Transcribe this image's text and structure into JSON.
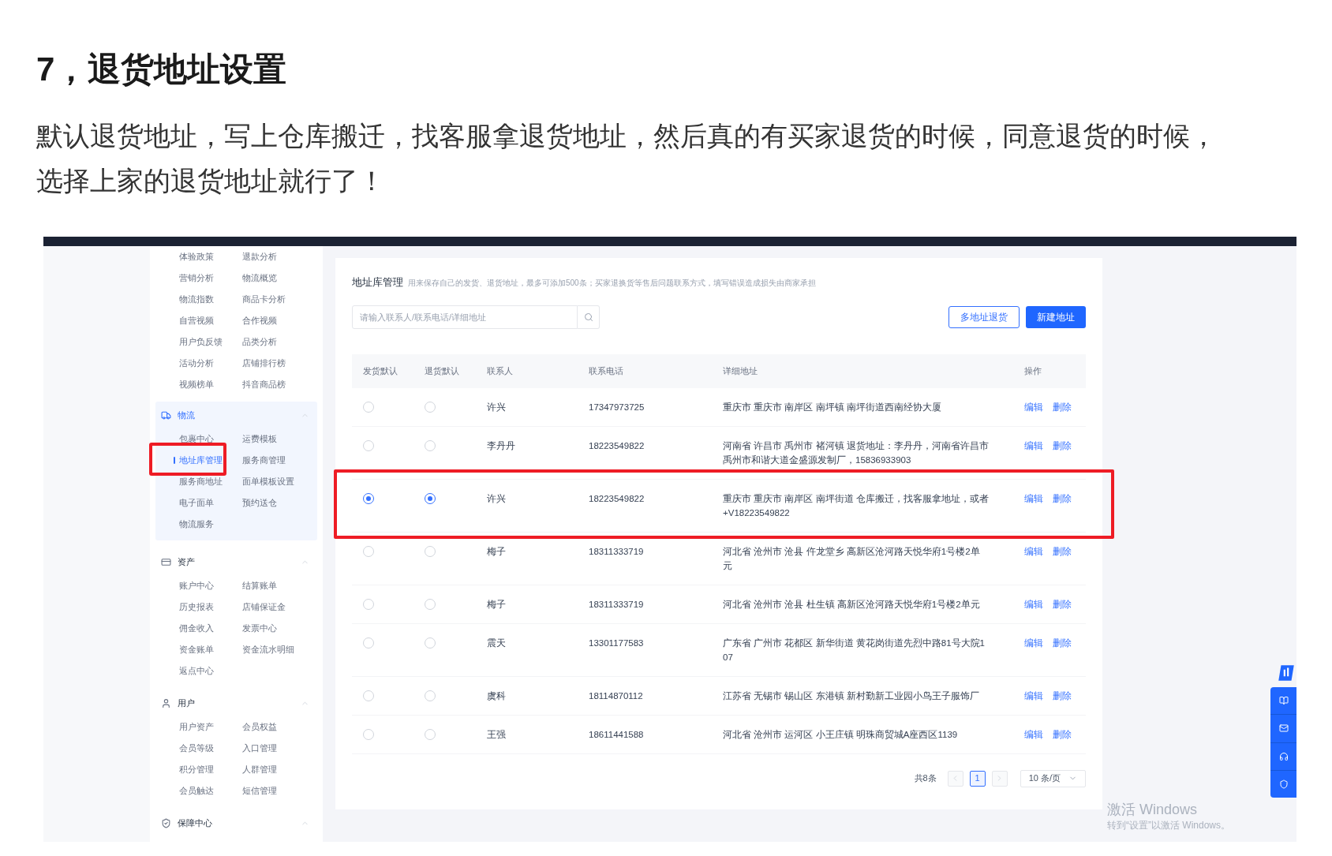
{
  "article": {
    "heading": "7，退货地址设置",
    "paragraph": "默认退货地址，写上仓库搬迁，找客服拿退货地址，然后真的有买家退货的时候，同意退货的时候，选择上家的退货地址就行了！"
  },
  "sidebar": {
    "groups": [
      {
        "items": [
          {
            "label": "体验政策",
            "selected": false,
            "highlighted": false
          },
          {
            "label": "退款分析",
            "selected": false,
            "highlighted": false
          },
          {
            "label": "营销分析",
            "selected": false,
            "highlighted": false
          },
          {
            "label": "物流概览",
            "selected": false,
            "highlighted": false
          },
          {
            "label": "物流指数",
            "selected": false,
            "highlighted": false
          },
          {
            "label": "商品卡分析",
            "selected": false,
            "highlighted": false
          },
          {
            "label": "自营视频",
            "selected": false,
            "highlighted": false
          },
          {
            "label": "合作视频",
            "selected": false,
            "highlighted": false
          },
          {
            "label": "用户负反馈",
            "selected": false,
            "highlighted": false
          },
          {
            "label": "品类分析",
            "selected": false,
            "highlighted": false
          },
          {
            "label": "活动分析",
            "selected": false,
            "highlighted": false
          },
          {
            "label": "店铺排行榜",
            "selected": false,
            "highlighted": false
          },
          {
            "label": "视频榜单",
            "selected": false,
            "highlighted": false
          },
          {
            "label": "抖音商品榜",
            "selected": false,
            "highlighted": false
          }
        ]
      },
      {
        "kind": "logistics",
        "title": "物流",
        "expanded": true,
        "items": [
          {
            "label": "包裹中心",
            "selected": false,
            "highlighted": false
          },
          {
            "label": "运费模板",
            "selected": false,
            "highlighted": false
          },
          {
            "label": "地址库管理",
            "selected": true,
            "highlighted": true
          },
          {
            "label": "服务商管理",
            "selected": false,
            "highlighted": false
          },
          {
            "label": "服务商地址",
            "selected": false,
            "highlighted": false
          },
          {
            "label": "面单模板设置",
            "selected": false,
            "highlighted": false
          },
          {
            "label": "电子面单",
            "selected": false,
            "highlighted": false
          },
          {
            "label": "预约送仓",
            "selected": false,
            "highlighted": false
          },
          {
            "label": "物流服务",
            "selected": false,
            "highlighted": false
          }
        ]
      },
      {
        "kind": "assets",
        "title": "资产",
        "expanded": true,
        "items": [
          {
            "label": "账户中心",
            "selected": false,
            "highlighted": false
          },
          {
            "label": "结算账单",
            "selected": false,
            "highlighted": false
          },
          {
            "label": "历史报表",
            "selected": false,
            "highlighted": false
          },
          {
            "label": "店铺保证金",
            "selected": false,
            "highlighted": false
          },
          {
            "label": "佣金收入",
            "selected": false,
            "highlighted": false
          },
          {
            "label": "发票中心",
            "selected": false,
            "highlighted": false
          },
          {
            "label": "资金账单",
            "selected": false,
            "highlighted": false
          },
          {
            "label": "资金流水明细",
            "selected": false,
            "highlighted": false
          },
          {
            "label": "返点中心",
            "selected": false,
            "highlighted": false
          }
        ]
      },
      {
        "kind": "users",
        "title": "用户",
        "expanded": true,
        "items": [
          {
            "label": "用户资产",
            "selected": false,
            "highlighted": false
          },
          {
            "label": "会员权益",
            "selected": false,
            "highlighted": false
          },
          {
            "label": "会员等级",
            "selected": false,
            "highlighted": false
          },
          {
            "label": "入口管理",
            "selected": false,
            "highlighted": false
          },
          {
            "label": "积分管理",
            "selected": false,
            "highlighted": false
          },
          {
            "label": "人群管理",
            "selected": false,
            "highlighted": false
          },
          {
            "label": "会员触达",
            "selected": false,
            "highlighted": false
          },
          {
            "label": "短信管理",
            "selected": false,
            "highlighted": false
          }
        ]
      },
      {
        "kind": "security",
        "title": "保障中心",
        "expanded": true
      }
    ]
  },
  "address_panel": {
    "title": "地址库管理",
    "description": "用来保存自己的发货、退货地址，最多可添加500条；买家退换货等售后问题联系方式，填写错误造成损失由商家承担",
    "search": {
      "placeholder": "请输入联系人/联系电话/详细地址"
    },
    "buttons": [
      {
        "label": "多地址退货",
        "kind": "outline"
      },
      {
        "label": "新建地址",
        "kind": "primary"
      }
    ],
    "table": {
      "columns": [
        "发货默认",
        "退货默认",
        "联系人",
        "联系电话",
        "详细地址",
        "操作"
      ],
      "rows": [
        {
          "ship_default": false,
          "return_default": false,
          "contact": "许兴",
          "phone": "17347973725",
          "address": [
            "重庆市 重庆市 南岸区 南坪镇 南坪街道西南经协大厦"
          ],
          "actions": [
            "编辑",
            "删除"
          ],
          "highlighted": false
        },
        {
          "ship_default": false,
          "return_default": false,
          "contact": "李丹丹",
          "phone": "18223549822",
          "address": [
            "河南省 许昌市 禹州市 褚河镇 退货地址：李丹丹，河南省许昌市",
            "禹州市和谐大道金盛源发制厂，15836933903"
          ],
          "actions": [
            "编辑",
            "删除"
          ],
          "highlighted": false
        },
        {
          "ship_default": true,
          "return_default": true,
          "contact": "许兴",
          "phone": "18223549822",
          "address": [
            "重庆市 重庆市 南岸区 南坪街道 仓库搬迁，找客服拿地址，或者",
            "+V18223549822"
          ],
          "actions": [
            "编辑",
            "删除"
          ],
          "highlighted": true
        },
        {
          "ship_default": false,
          "return_default": false,
          "contact": "梅子",
          "phone": "18311333719",
          "address": [
            "河北省 沧州市 沧县 仵龙堂乡 高新区沧河路天悦华府1号楼2单",
            "元"
          ],
          "actions": [
            "编辑",
            "删除"
          ],
          "highlighted": false
        },
        {
          "ship_default": false,
          "return_default": false,
          "contact": "梅子",
          "phone": "18311333719",
          "address": [
            "河北省 沧州市 沧县 杜生镇 高新区沧河路天悦华府1号楼2单元"
          ],
          "actions": [
            "编辑",
            "删除"
          ],
          "highlighted": false
        },
        {
          "ship_default": false,
          "return_default": false,
          "contact": "震天",
          "phone": "13301177583",
          "address": [
            "广东省 广州市 花都区 新华街道 黄花岗街道先烈中路81号大院1",
            "07"
          ],
          "actions": [
            "编辑",
            "删除"
          ],
          "highlighted": false
        },
        {
          "ship_default": false,
          "return_default": false,
          "contact": "虞科",
          "phone": "18114870112",
          "address": [
            "江苏省 无锡市 锡山区 东港镇 新村勤新工业园小鸟王子服饰厂"
          ],
          "actions": [
            "编辑",
            "删除"
          ],
          "highlighted": false
        },
        {
          "ship_default": false,
          "return_default": false,
          "contact": "王强",
          "phone": "18611441588",
          "address": [
            "河北省 沧州市 运河区 小王庄镇 明珠商贸城A座西区1139"
          ],
          "actions": [
            "编辑",
            "删除"
          ],
          "highlighted": false
        }
      ]
    },
    "pagination": {
      "total": "共8条",
      "pages": [
        {
          "label": "1",
          "selected": true
        }
      ],
      "page_size": "10 条/页"
    }
  },
  "windows_notice": {
    "title": "激活 Windows",
    "subtitle": "转到“设置”以激活 Windows。"
  }
}
